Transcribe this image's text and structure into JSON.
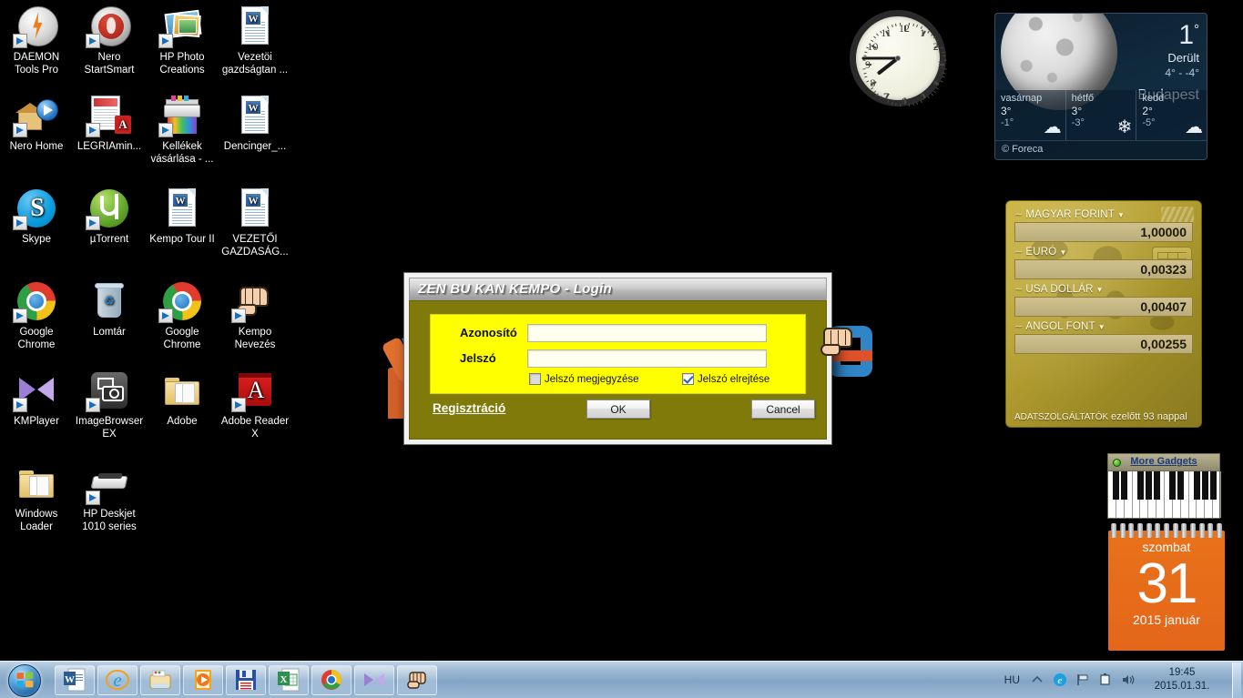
{
  "desktop": {
    "icons": [
      {
        "label": "DAEMON Tools Pro",
        "icon": "daemon-tools-icon",
        "shortcut": true
      },
      {
        "label": "Nero StartSmart",
        "icon": "nero-startsmart-icon",
        "shortcut": true
      },
      {
        "label": "HP Photo Creations",
        "icon": "hp-photo-creations-icon",
        "shortcut": true
      },
      {
        "label": "Vezetöi gazdságtan ...",
        "icon": "word-document-icon",
        "shortcut": false
      },
      {
        "label": "Nero Home",
        "icon": "nero-home-icon",
        "shortcut": true
      },
      {
        "label": "LEGRIAmin...",
        "icon": "pdf-document-icon",
        "shortcut": true
      },
      {
        "label": "Kellékek vásárlása - ...",
        "icon": "printer-icon",
        "shortcut": true
      },
      {
        "label": "Dencinger_...",
        "icon": "word-document-icon",
        "shortcut": false
      },
      {
        "label": "Skype",
        "icon": "skype-icon",
        "shortcut": true
      },
      {
        "label": "µTorrent",
        "icon": "utorrent-icon",
        "shortcut": true
      },
      {
        "label": "Kempo Tour II",
        "icon": "word-document-icon",
        "shortcut": false
      },
      {
        "label": "VEZETŐI GAZDASÁG...",
        "icon": "word-document-icon",
        "shortcut": false
      },
      {
        "label": "Google Chrome",
        "icon": "chrome-icon",
        "shortcut": true
      },
      {
        "label": "Lomtár",
        "icon": "recycle-bin-icon",
        "shortcut": false
      },
      {
        "label": "Google Chrome",
        "icon": "chrome-icon",
        "shortcut": true
      },
      {
        "label": "Kempo Nevezés",
        "icon": "fist-icon",
        "shortcut": true
      },
      {
        "label": "KMPlayer",
        "icon": "kmplayer-icon",
        "shortcut": true
      },
      {
        "label": "ImageBrowser EX",
        "icon": "imagebrowser-icon",
        "shortcut": true
      },
      {
        "label": "Adobe",
        "icon": "folder-icon",
        "shortcut": false
      },
      {
        "label": "Adobe Reader X",
        "icon": "adobe-reader-icon",
        "shortcut": true
      },
      {
        "label": "Windows Loader",
        "icon": "folder-icon",
        "shortcut": false
      },
      {
        "label": "HP Deskjet 1010 series",
        "icon": "printer-device-icon",
        "shortcut": true
      }
    ]
  },
  "clock_gadget": {
    "name": "analog-clock",
    "numbers": [
      "12",
      "1",
      "2",
      "3",
      "4",
      "5",
      "6",
      "7",
      "8",
      "9",
      "10",
      "11"
    ],
    "hour_angle": 232,
    "minute_angle": 270
  },
  "weather_gadget": {
    "temperature": "1",
    "degree": "°",
    "condition": "Derült",
    "range": "4° -  -4°",
    "city": "Budapest",
    "provider": "© Foreca",
    "forecast": [
      {
        "day": "vasárnap",
        "high": "3°",
        "low": "-1°",
        "symbol": "☁",
        "icon": "cloudy-icon"
      },
      {
        "day": "hétfő",
        "high": "3°",
        "low": "-3°",
        "symbol": "❄",
        "icon": "snow-icon"
      },
      {
        "day": "kedd",
        "high": "2°",
        "low": "-5°",
        "symbol": "☁",
        "icon": "cloudy-icon"
      }
    ]
  },
  "currency_gadget": {
    "rows": [
      {
        "label": "MAGYAR FORINT",
        "value": "1,00000"
      },
      {
        "label": "EURÓ",
        "value": "0,00323"
      },
      {
        "label": "USA DOLLÁR",
        "value": "0,00407"
      },
      {
        "label": "ANGOL FONT",
        "value": "0,00255"
      }
    ],
    "footer_label": "ADATSZOLGÁLTATÓK",
    "footer_ago": "ezelőtt 93 nappal"
  },
  "piano_gadget": {
    "link": "More Gadgets"
  },
  "calendar_gadget": {
    "day_of_week": "szombat",
    "day": "31",
    "month_year": "2015 január"
  },
  "dialog": {
    "title": "ZEN BU KAN KEMPO - Login",
    "fields": [
      {
        "label": "Azonosító",
        "value": "",
        "placeholder": "",
        "name": "username-input"
      },
      {
        "label": "Jelszó",
        "value": "",
        "placeholder": "",
        "name": "password-input"
      }
    ],
    "checkboxes": [
      {
        "label": "Jelszó megjegyzése",
        "checked": false
      },
      {
        "label": "Jelszó elrejtése",
        "checked": true
      }
    ],
    "register_link": "Regisztráció",
    "ok_label": "OK",
    "cancel_label": "Cancel",
    "colors": {
      "panel": "#ffff00",
      "body": "#7f7a09",
      "input": "#fffff0"
    }
  },
  "taskbar": {
    "start_label": "Start",
    "buttons": [
      {
        "name": "taskbar-word",
        "icon": "word-icon"
      },
      {
        "name": "taskbar-internet-explorer",
        "icon": "internet-explorer-icon"
      },
      {
        "name": "taskbar-explorer",
        "icon": "folder-explorer-icon"
      },
      {
        "name": "taskbar-media-player",
        "icon": "windows-media-player-icon"
      },
      {
        "name": "taskbar-save-app",
        "icon": "floppy-disk-icon"
      },
      {
        "name": "taskbar-excel",
        "icon": "excel-icon"
      },
      {
        "name": "taskbar-chrome",
        "icon": "chrome-icon"
      },
      {
        "name": "taskbar-kmplayer",
        "icon": "kmplayer-icon"
      },
      {
        "name": "taskbar-kempo",
        "icon": "fist-icon"
      }
    ],
    "tray": {
      "language": "HU",
      "icons": [
        "show-hidden-icons-chevron",
        "internet-explorer-icon",
        "network-flag-icon",
        "action-center-icon",
        "volume-icon"
      ],
      "time": "19:45",
      "date": "2015.01.31."
    }
  }
}
